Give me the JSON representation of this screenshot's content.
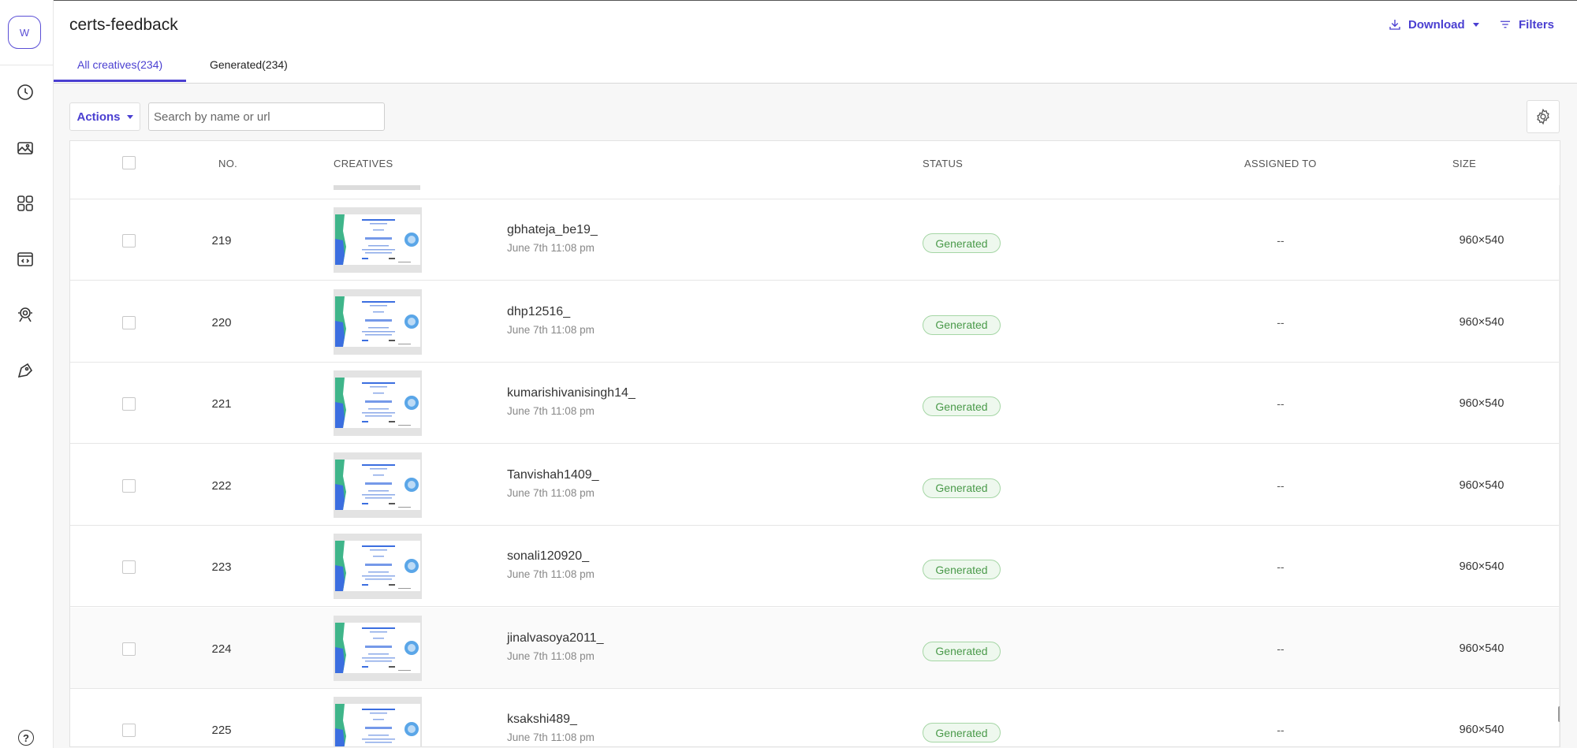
{
  "sidebar": {
    "avatar_letter": "W",
    "nav_icons": [
      "clock-icon",
      "image-icon",
      "grid-icon",
      "code-icon",
      "camera-icon",
      "tag-icon"
    ],
    "help_label": "?"
  },
  "header": {
    "title": "certs-feedback",
    "download_label": "Download",
    "filters_label": "Filters"
  },
  "tabs": [
    {
      "label": "All creatives(234)",
      "active": true
    },
    {
      "label": "Generated(234)",
      "active": false
    }
  ],
  "toolbar": {
    "actions_label": "Actions",
    "search_placeholder": "Search by name or url"
  },
  "table": {
    "columns": {
      "no": "NO.",
      "creatives": "CREATIVES",
      "status": "STATUS",
      "assigned": "ASSIGNED TO",
      "size": "SIZE"
    },
    "rows": [
      {
        "no": "219",
        "name": "gbhateja_be19_",
        "date": "June 7th 11:08 pm",
        "status": "Generated",
        "assigned": "--",
        "size": "960×540"
      },
      {
        "no": "220",
        "name": "dhp12516_",
        "date": "June 7th 11:08 pm",
        "status": "Generated",
        "assigned": "--",
        "size": "960×540"
      },
      {
        "no": "221",
        "name": "kumarishivanisingh14_",
        "date": "June 7th 11:08 pm",
        "status": "Generated",
        "assigned": "--",
        "size": "960×540"
      },
      {
        "no": "222",
        "name": "Tanvishah1409_",
        "date": "June 7th 11:08 pm",
        "status": "Generated",
        "assigned": "--",
        "size": "960×540"
      },
      {
        "no": "223",
        "name": "sonali120920_",
        "date": "June 7th 11:08 pm",
        "status": "Generated",
        "assigned": "--",
        "size": "960×540"
      },
      {
        "no": "224",
        "name": "jinalvasoya2011_",
        "date": "June 7th 11:08 pm",
        "status": "Generated",
        "assigned": "--",
        "size": "960×540"
      },
      {
        "no": "225",
        "name": "ksakshi489_",
        "date": "June 7th 11:08 pm",
        "status": "Generated",
        "assigned": "--",
        "size": "960×540"
      }
    ]
  },
  "colors": {
    "accent": "#4a3fd1",
    "status_green": "#4a9a4a",
    "status_bg": "#eef8ee"
  }
}
